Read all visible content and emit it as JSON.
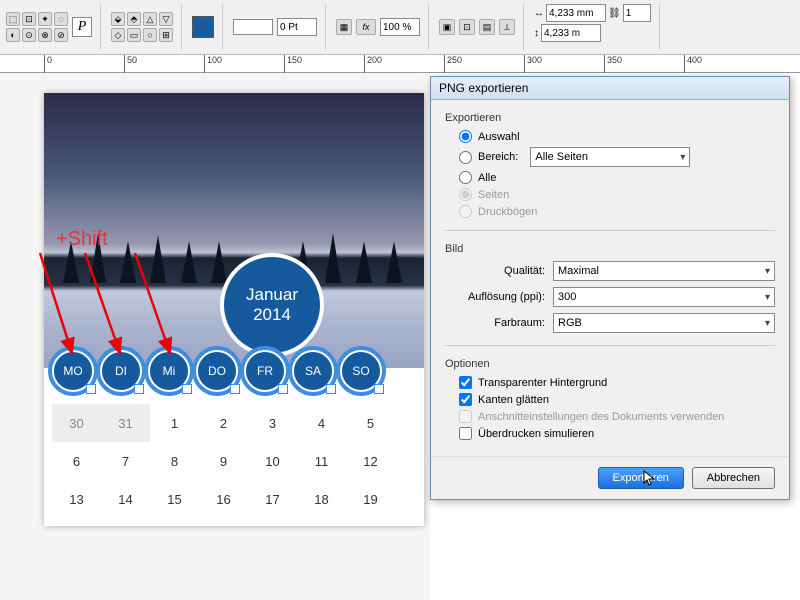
{
  "toolbar": {
    "stroke_weight": "0 Pt",
    "zoom": "100 %",
    "dim_x": "4,233 mm",
    "dim_y": "4,233 m",
    "count": "1",
    "p_label": "P"
  },
  "ruler": {
    "marks": [
      "0",
      "50",
      "100",
      "150",
      "200",
      "250",
      "300",
      "350",
      "400"
    ]
  },
  "canvas": {
    "shift_label": "+Shift",
    "month": "Januar",
    "year": "2014",
    "days": [
      "MO",
      "DI",
      "Mi",
      "DO",
      "FR",
      "SA",
      "SO"
    ],
    "rows": [
      [
        "30",
        "31",
        "1",
        "2",
        "3",
        "4",
        "5"
      ],
      [
        "6",
        "7",
        "8",
        "9",
        "10",
        "11",
        "12"
      ],
      [
        "13",
        "14",
        "15",
        "16",
        "17",
        "18",
        "19"
      ]
    ]
  },
  "dialog": {
    "title": "PNG exportieren",
    "sec_export": "Exportieren",
    "opt_selection": "Auswahl",
    "opt_range": "Bereich:",
    "range_value": "Alle Seiten",
    "opt_all": "Alle",
    "opt_pages": "Seiten",
    "opt_spreads": "Druckbögen",
    "sec_image": "Bild",
    "lbl_quality": "Qualität:",
    "val_quality": "Maximal",
    "lbl_res": "Auflösung (ppi):",
    "val_res": "300",
    "lbl_colorspace": "Farbraum:",
    "val_colorspace": "RGB",
    "sec_options": "Optionen",
    "chk_transparent": "Transparenter Hintergrund",
    "chk_smooth": "Kanten glätten",
    "chk_bleed": "Anschnitteinstellungen des Dokuments verwenden",
    "chk_overprint": "Überdrucken simulieren",
    "btn_export": "Exportieren",
    "btn_cancel": "Abbrechen"
  }
}
